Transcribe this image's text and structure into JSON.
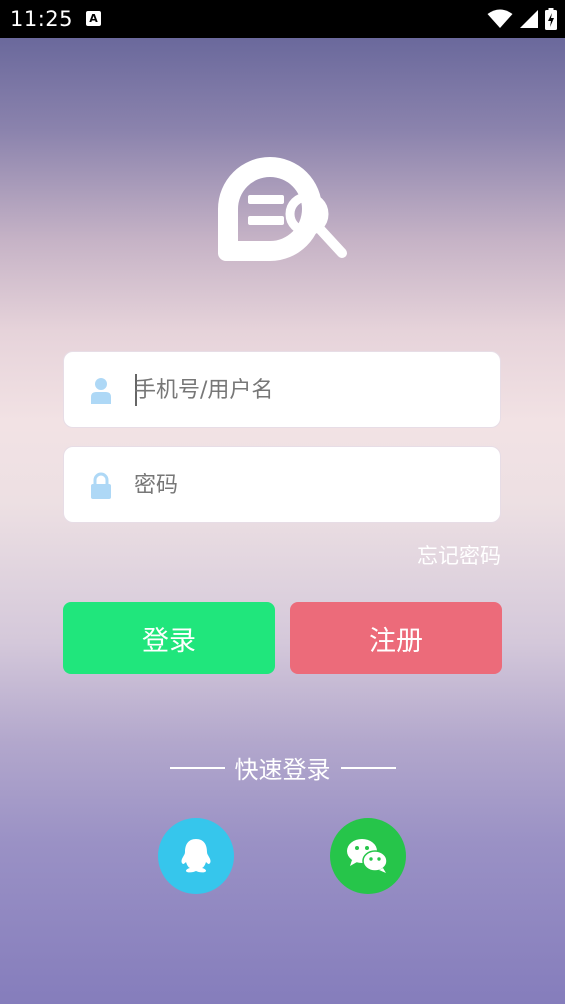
{
  "status_bar": {
    "time": "11:25",
    "notification_icon": "A",
    "icons": [
      "wifi-icon",
      "signal-icon",
      "battery-icon"
    ]
  },
  "logo": {
    "icon": "eq-search-logo-icon"
  },
  "login_form": {
    "username": {
      "placeholder": "手机号/用户名",
      "value": "",
      "icon": "user-icon"
    },
    "password": {
      "placeholder": "密码",
      "value": "",
      "icon": "lock-icon"
    },
    "forgot_password": "忘记密码"
  },
  "buttons": {
    "login": "登录",
    "register": "注册"
  },
  "quick_login": {
    "title": "快速登录",
    "providers": [
      {
        "name": "qq-icon",
        "color": "#36c6ec"
      },
      {
        "name": "wechat-icon",
        "color": "#26c54a"
      }
    ]
  },
  "colors": {
    "login_button": "#20e67c",
    "register_button": "#ec6b7a",
    "field_icon": "#aed8f6"
  }
}
